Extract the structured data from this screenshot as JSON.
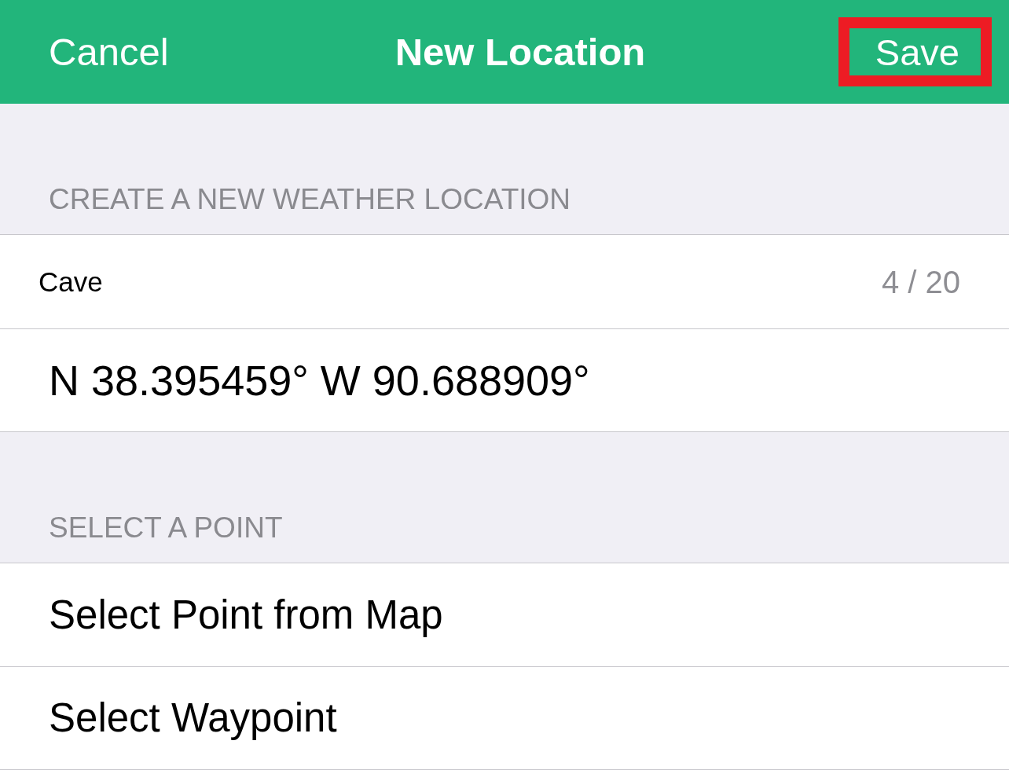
{
  "nav": {
    "cancel": "Cancel",
    "title": "New Location",
    "save": {
      "label": "Save",
      "highlighted": true
    }
  },
  "sections": [
    {
      "header": "CREATE A NEW WEATHER LOCATION",
      "rows": [
        {
          "kind": "input",
          "value": "Cave",
          "counter": "4 / 20"
        },
        {
          "kind": "text",
          "label": "N 38.395459° W 90.688909°"
        }
      ]
    },
    {
      "header": "SELECT A POINT",
      "rows": [
        {
          "kind": "action",
          "label": "Select Point from Map"
        },
        {
          "kind": "action",
          "label": "Select Waypoint"
        }
      ]
    }
  ]
}
